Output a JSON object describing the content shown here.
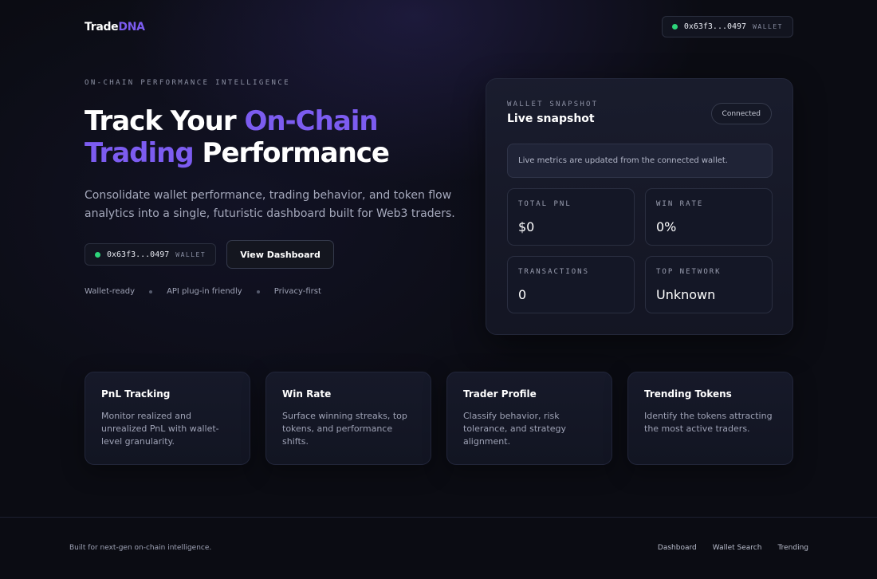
{
  "header": {
    "logo_main": "Trade",
    "logo_accent": "DNA",
    "wallet": {
      "address": "0x63f3...0497",
      "label": "WALLET"
    }
  },
  "hero": {
    "eyebrow": "ON-CHAIN PERFORMANCE INTELLIGENCE",
    "title_part1": "Track Your ",
    "title_highlight1": "On-Chain",
    "title_highlight2": "Trading",
    "title_part2": " Performance",
    "description": "Consolidate wallet performance, trading behavior, and token flow analytics into a single, futuristic dashboard built for Web3 traders.",
    "wallet": {
      "address": "0x63f3...0497",
      "label": "WALLET"
    },
    "dashboard_button": "View Dashboard",
    "features": [
      "Wallet-ready",
      "API plug-in friendly",
      "Privacy-first"
    ]
  },
  "snapshot": {
    "eyebrow": "WALLET SNAPSHOT",
    "title": "Live snapshot",
    "status": "Connected",
    "notice": "Live metrics are updated from the connected wallet.",
    "metrics": [
      {
        "label": "TOTAL PNL",
        "value": "$0"
      },
      {
        "label": "WIN RATE",
        "value": "0%"
      },
      {
        "label": "TRANSACTIONS",
        "value": "0"
      },
      {
        "label": "TOP NETWORK",
        "value": "Unknown"
      }
    ]
  },
  "features": [
    {
      "title": "PnL Tracking",
      "description": "Monitor realized and unrealized PnL with wallet-level granularity."
    },
    {
      "title": "Win Rate",
      "description": "Surface winning streaks, top tokens, and performance shifts."
    },
    {
      "title": "Trader Profile",
      "description": "Classify behavior, risk tolerance, and strategy alignment."
    },
    {
      "title": "Trending Tokens",
      "description": "Identify the tokens attracting the most active traders."
    }
  ],
  "footer": {
    "note": "Built for next-gen on-chain intelligence.",
    "links": [
      "Dashboard",
      "Wallet Search",
      "Trending"
    ]
  },
  "colors": {
    "accent": "#7c5cf0",
    "status_green": "#2dd47a",
    "background": "#0b0c13"
  }
}
